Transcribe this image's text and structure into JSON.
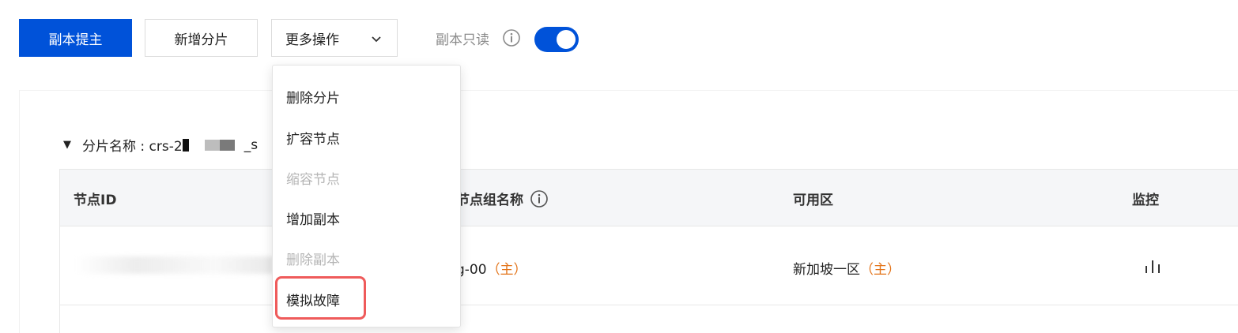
{
  "toolbar": {
    "promote_label": "副本提主",
    "add_shard_label": "新增分片",
    "more_label": "更多操作",
    "readonly_label": "副本只读",
    "readonly_on": true
  },
  "shard": {
    "name_prefix": "分片名称 : crs-2",
    "name_suffix": "_s"
  },
  "table": {
    "columns": [
      "节点ID",
      "节点组名称",
      "可用区",
      "监控"
    ],
    "rows": [
      {
        "group_name_prefix": "g-00",
        "group_role": "（主）",
        "zone": "新加坡一区",
        "zone_role": "（主）"
      }
    ]
  },
  "menu": {
    "items": [
      {
        "label": "删除分片",
        "disabled": false
      },
      {
        "label": "扩容节点",
        "disabled": false
      },
      {
        "label": "缩容节点",
        "disabled": true
      },
      {
        "label": "增加副本",
        "disabled": false
      },
      {
        "label": "删除副本",
        "disabled": true
      },
      {
        "label": "模拟故障",
        "disabled": false
      }
    ]
  },
  "colors": {
    "primary": "#0052d9",
    "orange": "#e37318",
    "highlight": "#ef5b5b"
  },
  "icons": [
    "chevron-down-icon",
    "info-icon",
    "bar-chart-icon",
    "caret-down-icon"
  ]
}
